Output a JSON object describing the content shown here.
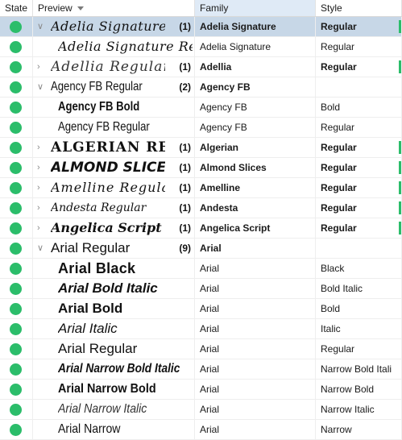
{
  "header": {
    "state": "State",
    "preview": "Preview",
    "family": "Family",
    "style": "Style"
  },
  "rows": [
    {
      "preview": "Adelia Signature Regular",
      "count": "(1)",
      "family": "Adelia Signature",
      "style": "Regular",
      "type": "group",
      "expanded": true,
      "selected": true,
      "font": "f-script"
    },
    {
      "preview": "Adelia Signature Regular",
      "count": "",
      "family": "Adelia Signature",
      "style": "Regular",
      "type": "child",
      "font": "f-script"
    },
    {
      "preview": "Adellia Regular",
      "count": "(1)",
      "family": "Adellia",
      "style": "Regular",
      "type": "group",
      "expanded": false,
      "font": "f-script-l"
    },
    {
      "preview": "Agency FB Regular",
      "count": "(2)",
      "family": "Agency FB",
      "style": "",
      "type": "group",
      "expanded": true,
      "font": "f-cond"
    },
    {
      "preview": "Agency FB Bold",
      "count": "",
      "family": "Agency FB",
      "style": "Bold",
      "type": "child",
      "font": "f-cond-b"
    },
    {
      "preview": "Agency FB Regular",
      "count": "",
      "family": "Agency FB",
      "style": "Regular",
      "type": "child",
      "font": "f-cond"
    },
    {
      "preview": "ALGERIAN REGULAR",
      "count": "(1)",
      "family": "Algerian",
      "style": "Regular",
      "type": "group",
      "expanded": false,
      "font": "f-alg"
    },
    {
      "preview": "ALMOND SLICES REGULAR",
      "count": "(1)",
      "family": "Almond Slices",
      "style": "Regular",
      "type": "group",
      "expanded": false,
      "font": "f-almond"
    },
    {
      "preview": "Amelline Regular",
      "count": "(1)",
      "family": "Amelline",
      "style": "Regular",
      "type": "group",
      "expanded": false,
      "font": "f-ameline"
    },
    {
      "preview": "Andesta Regular",
      "count": "(1)",
      "family": "Andesta",
      "style": "Regular",
      "type": "group",
      "expanded": false,
      "font": "f-andesta"
    },
    {
      "preview": "Angelica Script Regular",
      "count": "(1)",
      "family": "Angelica Script",
      "style": "Regular",
      "type": "group",
      "expanded": false,
      "font": "f-angel"
    },
    {
      "preview": "Arial Regular",
      "count": "(9)",
      "family": "Arial",
      "style": "",
      "type": "group",
      "expanded": true,
      "font": "f-arial"
    },
    {
      "preview": "Arial Black",
      "count": "",
      "family": "Arial",
      "style": "Black",
      "type": "child",
      "font": "f-arial-black"
    },
    {
      "preview": "Arial Bold Italic",
      "count": "",
      "family": "Arial",
      "style": "Bold Italic",
      "type": "child",
      "font": "f-arial-bi"
    },
    {
      "preview": "Arial Bold",
      "count": "",
      "family": "Arial",
      "style": "Bold",
      "type": "child",
      "font": "f-arial-b"
    },
    {
      "preview": "Arial Italic",
      "count": "",
      "family": "Arial",
      "style": "Italic",
      "type": "child",
      "font": "f-arial-i"
    },
    {
      "preview": "Arial Regular",
      "count": "",
      "family": "Arial",
      "style": "Regular",
      "type": "child",
      "font": "f-arial"
    },
    {
      "preview": "Arial Narrow Bold Italic",
      "count": "",
      "family": "Arial",
      "style": "Narrow Bold Itali",
      "type": "child",
      "font": "f-narrow-bi"
    },
    {
      "preview": "Arial Narrow Bold",
      "count": "",
      "family": "Arial",
      "style": "Narrow Bold",
      "type": "child",
      "font": "f-narrow-b"
    },
    {
      "preview": "Arial Narrow Italic",
      "count": "",
      "family": "Arial",
      "style": "Narrow Italic",
      "type": "child",
      "font": "f-narrow-i"
    },
    {
      "preview": "Arial Narrow",
      "count": "",
      "family": "Arial",
      "style": "Narrow",
      "type": "child",
      "font": "f-narrow"
    }
  ],
  "icons": {
    "state": "status-dot-icon",
    "expanded": "chevron-down-icon",
    "collapsed": "chevron-right-icon",
    "sort": "sort-down-icon"
  },
  "colors": {
    "state_active": "#2bbd6a",
    "selected_row": "#c7d7e7",
    "sorted_header": "#dfeaf6"
  }
}
